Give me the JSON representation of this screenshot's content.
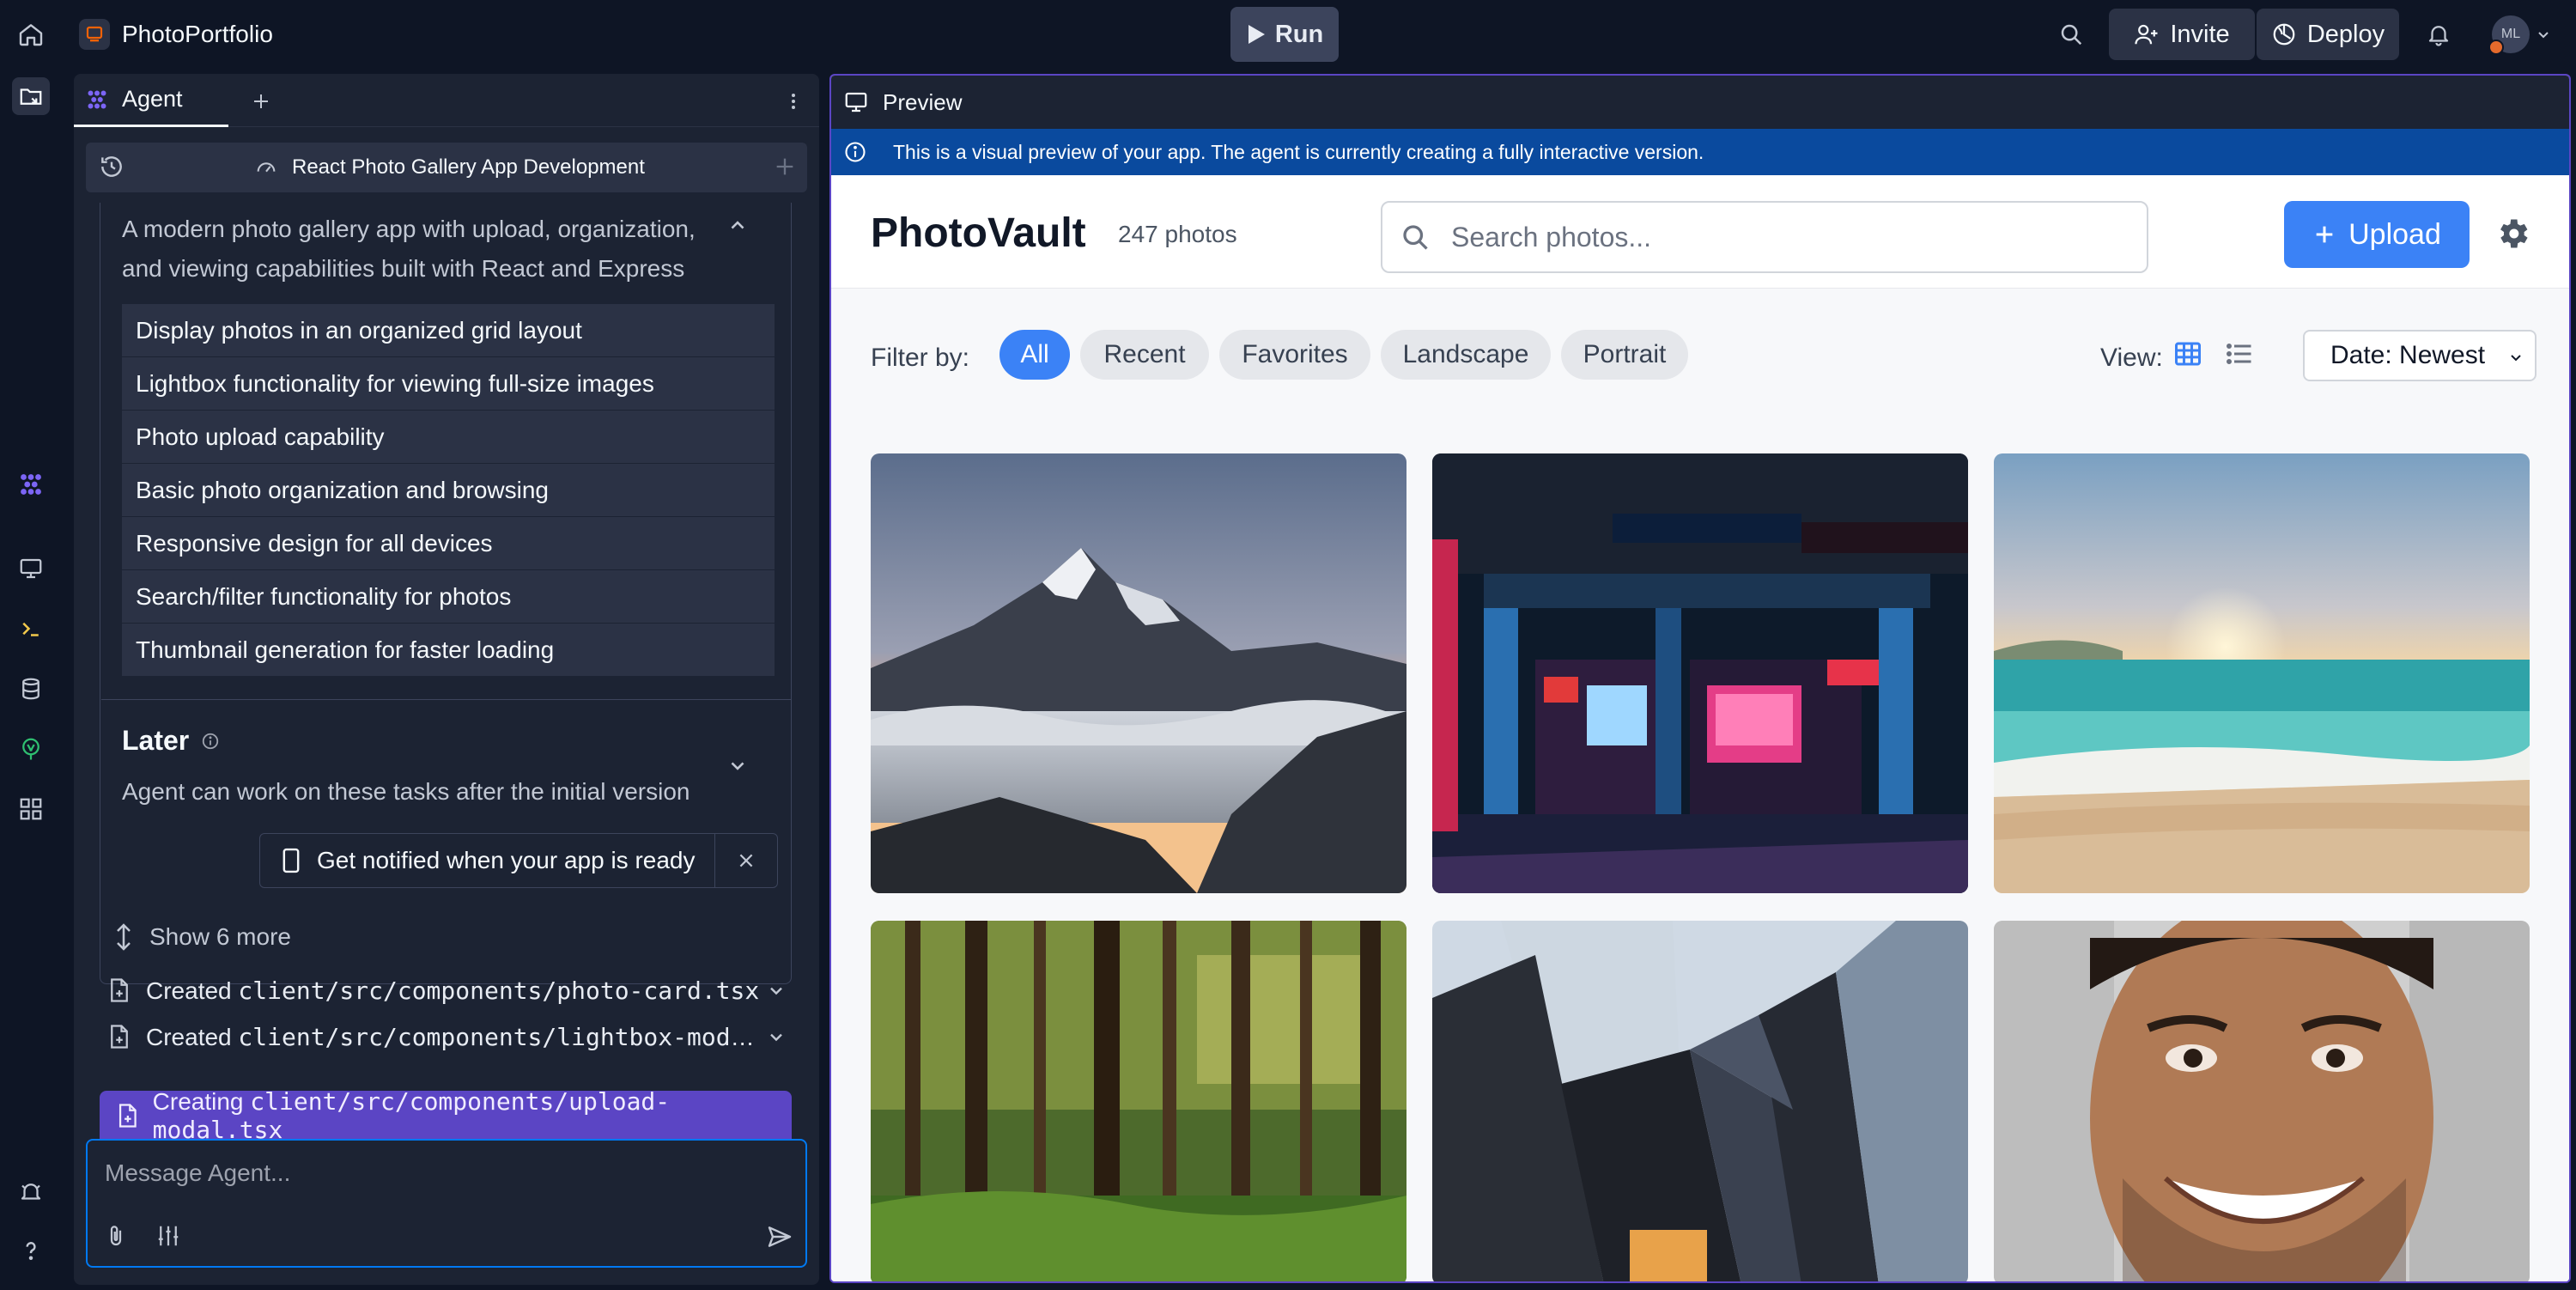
{
  "topbar": {
    "app_name": "PhotoPortfolio",
    "run_label": "Run",
    "invite_label": "Invite",
    "deploy_label": "Deploy",
    "avatar_initials": "ML"
  },
  "agent": {
    "tab_label": "Agent",
    "session_title": "React Photo Gallery App Development",
    "plan_description": "A modern photo gallery app with upload, organization, and viewing capabilities built with React and Express",
    "features": [
      "Display photos in an organized grid layout",
      "Lightbox functionality for viewing full-size images",
      "Photo upload capability",
      "Basic photo organization and browsing",
      "Responsive design for all devices",
      "Search/filter functionality for photos",
      "Thumbnail generation for faster loading"
    ],
    "later_title": "Later",
    "later_description": "Agent can work on these tasks after the initial version",
    "notify_label": "Get notified when your app is ready",
    "show_more": "Show 6 more",
    "files": [
      {
        "prefix": "Created",
        "path": "client/src/components/photo-card.tsx"
      },
      {
        "prefix": "Created",
        "path": "client/src/components/lightbox-modal..."
      }
    ],
    "creating": {
      "prefix": "Creating",
      "path": "client/src/components/upload-modal.tsx"
    },
    "message_placeholder": "Message Agent..."
  },
  "preview": {
    "tab_label": "Preview",
    "info_text": "This is a visual preview of your app. The agent is currently creating a fully interactive version.",
    "brand": "PhotoVault",
    "photo_count": "247 photos",
    "search_placeholder": "Search photos...",
    "upload_label": "Upload",
    "filter_label": "Filter by:",
    "filters": [
      "All",
      "Recent",
      "Favorites",
      "Landscape",
      "Portrait"
    ],
    "active_filter": "All",
    "view_label": "View:",
    "sort_value": "Date: Newest",
    "accent": "#3b82f6",
    "photos": [
      {
        "subject": "mountain-sunset-clouds"
      },
      {
        "subject": "neon-street-storefront"
      },
      {
        "subject": "beach-sunset-waves"
      },
      {
        "subject": "forest-trees"
      },
      {
        "subject": "skyscrapers"
      },
      {
        "subject": "smiling-man-portrait"
      }
    ]
  }
}
